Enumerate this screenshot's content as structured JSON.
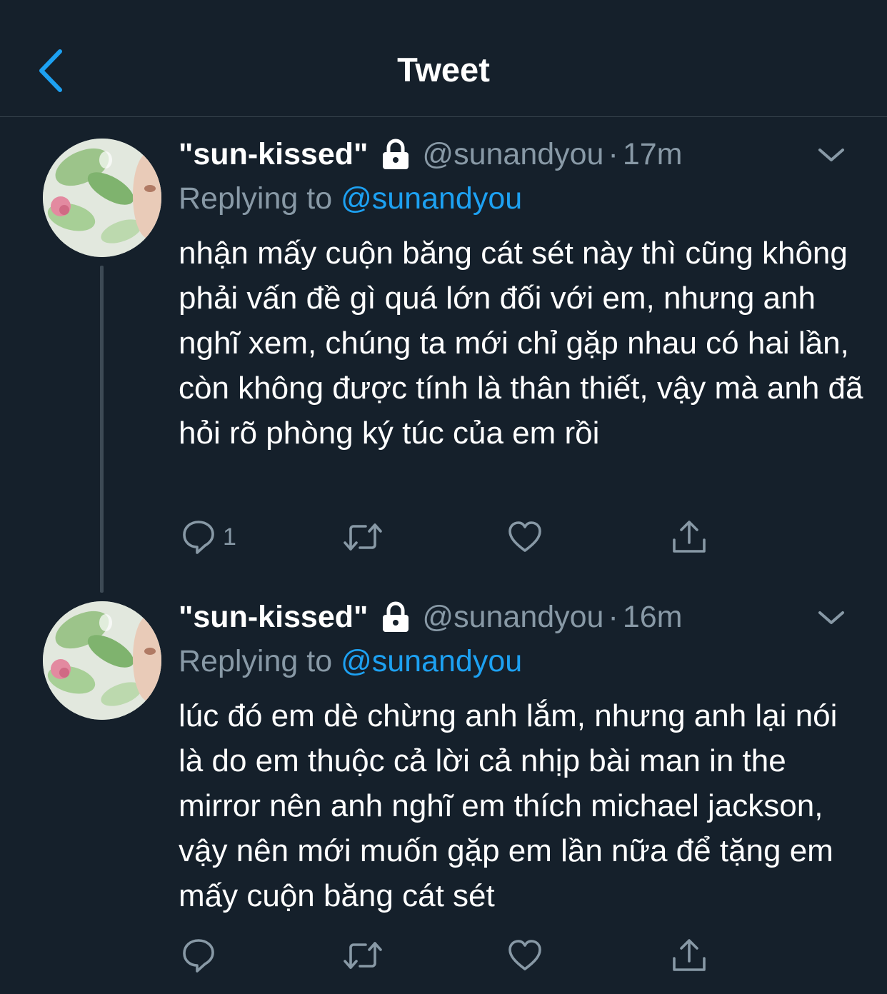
{
  "header": {
    "title": "Tweet",
    "back_icon": "chevron-left-icon",
    "accent_color": "#1da1f2"
  },
  "tweets": [
    {
      "display_name": "\"sun-kissed\"",
      "handle": "@sunandyou",
      "separator": "·",
      "time": "17m",
      "replying_prefix": "Replying to",
      "replying_to": "@sunandyou",
      "text": "nhận mấy cuộn băng cát sét này thì cũng không phải vấn đề gì quá lớn đối với em, nhưng anh nghĩ xem, chúng ta mới chỉ gặp nhau có hai lần, còn không được tính là thân thiết, vậy mà anh đã hỏi rõ phòng ký túc của em rồi",
      "reply_count": "1"
    },
    {
      "display_name": "\"sun-kissed\"",
      "handle": "@sunandyou",
      "separator": "·",
      "time": "16m",
      "replying_prefix": "Replying to",
      "replying_to": "@sunandyou",
      "text": "lúc đó em dè chừng anh lắm, nhưng anh lại nói là do em thuộc cả lời cả nhịp bài man in the mirror nên anh nghĩ em thích michael jackson, vậy nên mới muốn gặp em lần nữa để tặng em mấy cuộn băng cát sét",
      "reply_count": ""
    }
  ],
  "icons": [
    "lock-icon",
    "chevron-down-icon",
    "reply-icon",
    "retweet-icon",
    "like-icon",
    "share-icon"
  ]
}
